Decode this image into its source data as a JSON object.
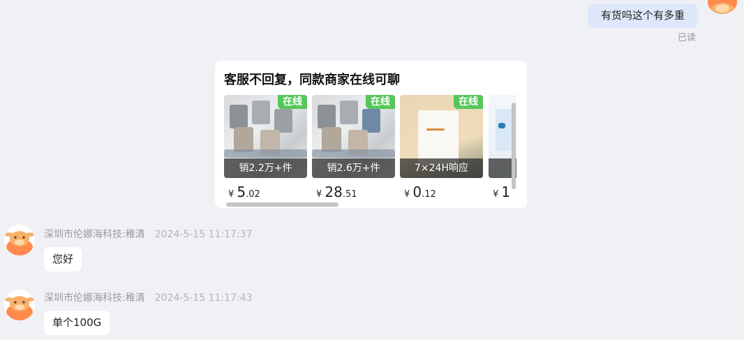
{
  "messages": {
    "outgoing_1": {
      "text": "有货吗这个有多重",
      "status": "已读"
    },
    "incoming_1": {
      "sender": "深圳市伦娜海科技:稚清",
      "time": "2024-5-15 11:17:37",
      "text": "您好"
    },
    "incoming_2": {
      "sender": "深圳市伦娜海科技:稚清",
      "time": "2024-5-15 11:17:43",
      "text": "单个100G"
    }
  },
  "recommend_card": {
    "title": "客服不回复，同款商家在线可聊",
    "products": [
      {
        "badge": "在线",
        "overlay": "销2.2万+件",
        "currency": "¥",
        "price_int": "5",
        "price_dec": ".02"
      },
      {
        "badge": "在线",
        "overlay": "销2.6万+件",
        "currency": "¥",
        "price_int": "28",
        "price_dec": ".51"
      },
      {
        "badge": "在线",
        "overlay": "7×24H响应",
        "currency": "¥",
        "price_int": "0",
        "price_dec": ".12"
      },
      {
        "badge": "",
        "overlay": "销",
        "currency": "¥",
        "price_int": "1",
        "price_dec": ""
      }
    ]
  },
  "colors": {
    "background": "#f0f1f5",
    "online_badge": "#55c75a",
    "outgoing_bubble": "#dfe8fb",
    "avatar_orange": "#ff8a4c"
  },
  "icons": {
    "avatar": "cartoon-cow-avatar-icon"
  }
}
